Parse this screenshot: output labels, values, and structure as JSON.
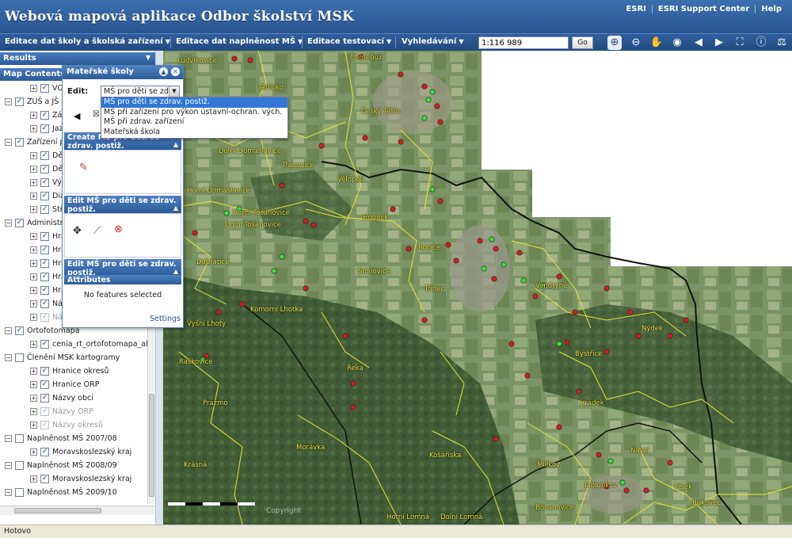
{
  "header": {
    "title": "Webová mapová aplikace Odbor školství MSK",
    "links": [
      "ESRI",
      "ESRI Support Center",
      "Help"
    ]
  },
  "toolbar": {
    "menus": [
      {
        "label": "Editace dat školy a školská zařízení"
      },
      {
        "label": "Editace dat naplněnost MŠ"
      },
      {
        "label": "Editace testovací"
      },
      {
        "label": "Vyhledávání"
      }
    ],
    "scale_value": "1:116 989",
    "go_label": "Go",
    "tools": [
      "zoom-in-icon",
      "zoom-out-icon",
      "pan-hand-icon",
      "globe-icon",
      "back-arrow-icon",
      "forward-arrow-icon",
      "full-extent-icon",
      "info-icon",
      "measure-icon"
    ]
  },
  "left_panel": {
    "results_label": "Results",
    "map_contents_label": "Map Contents",
    "toc": [
      {
        "level": 2,
        "expander": "+",
        "checked": true,
        "label": "VO"
      },
      {
        "level": 0,
        "expander": "-",
        "checked": true,
        "label": "ZUŠ a JŠ"
      },
      {
        "level": 2,
        "expander": "+",
        "checked": true,
        "label": "Zák"
      },
      {
        "level": 2,
        "expander": "+",
        "checked": true,
        "label": "Jazy"
      },
      {
        "level": 0,
        "expander": "-",
        "checked": true,
        "label": "Zařízení p"
      },
      {
        "level": 2,
        "expander": "+",
        "checked": true,
        "label": "Dět"
      },
      {
        "level": 2,
        "expander": "+",
        "checked": true,
        "label": "Dět"
      },
      {
        "level": 2,
        "expander": "+",
        "checked": true,
        "label": "Výc"
      },
      {
        "level": 2,
        "expander": "+",
        "checked": true,
        "label": "Diag"
      },
      {
        "level": 2,
        "expander": "+",
        "checked": true,
        "label": "Stř"
      },
      {
        "level": 0,
        "expander": "-",
        "checked": true,
        "label": "Administra"
      },
      {
        "level": 2,
        "expander": "+",
        "checked": true,
        "label": "Hrani"
      },
      {
        "level": 2,
        "expander": "+",
        "checked": true,
        "label": "Hrani"
      },
      {
        "level": 2,
        "expander": "+",
        "checked": true,
        "label": "Hrani"
      },
      {
        "level": 2,
        "expander": "+",
        "checked": true,
        "label": "Hrani"
      },
      {
        "level": 2,
        "expander": "+",
        "checked": true,
        "label": "Hrani"
      },
      {
        "level": 2,
        "expander": "+",
        "checked": true,
        "label": "Názv"
      },
      {
        "level": 2,
        "expander": "+",
        "checked": true,
        "dim": true,
        "label": "Názv"
      },
      {
        "level": 0,
        "expander": "-",
        "checked": true,
        "label": "Ortofotomapa"
      },
      {
        "level": 2,
        "expander": "+",
        "checked": true,
        "label": "cenia_rt_ortofotomapa_akt"
      },
      {
        "level": 0,
        "expander": "-",
        "checked": false,
        "label": "Členění MSK kartogramy"
      },
      {
        "level": 2,
        "expander": "+",
        "checked": true,
        "label": "Hranice okresů"
      },
      {
        "level": 2,
        "expander": "+",
        "checked": true,
        "label": "Hranice ORP"
      },
      {
        "level": 2,
        "expander": "+",
        "checked": true,
        "label": "Názvy obcí"
      },
      {
        "level": 2,
        "expander": "+",
        "checked": true,
        "dim": true,
        "label": "Názvy ORP"
      },
      {
        "level": 2,
        "expander": "+",
        "checked": true,
        "dim": true,
        "label": "Názvy okresů"
      },
      {
        "level": 0,
        "expander": "-",
        "checked": false,
        "label": "Naplněnost MŠ 2007/08"
      },
      {
        "level": 2,
        "expander": "+",
        "checked": true,
        "label": "Moravskoslezský kraj"
      },
      {
        "level": 0,
        "expander": "-",
        "checked": false,
        "label": "Naplněnost MŠ 2008/09"
      },
      {
        "level": 2,
        "expander": "+",
        "checked": true,
        "label": "Moravskoslezský kraj"
      },
      {
        "level": 0,
        "expander": "-",
        "checked": false,
        "label": "Naplněnost MŠ 2009/10"
      }
    ]
  },
  "editor": {
    "title": "Mateřské školy",
    "edit_label": "Edit:",
    "selected_value": "MŠ pro děti se zdrav. postiž.",
    "options": [
      "MŠ pro děti se zdrav. postiž.",
      "MŠ při zařízení pro výkon ústavní-ochran. vých.",
      "MŠ při zdrav. zařízení",
      "Mateřská škola"
    ],
    "create_title": "Create MŠ pro děti se zdrav. postiž.",
    "edit_title": "Edit MŠ pro děti se zdrav. postiž.",
    "edit_title_2": "Edit MŠ pro děti se zdrav. postiž.",
    "attributes_title": "Attributes",
    "no_features": "No features selected",
    "settings_label": "Settings"
  },
  "map": {
    "places": [
      "Ludvíkovice",
      "Ropice",
      "Český Těšín",
      "Těrlicko",
      "Dolní Domaslavice",
      "Třanovice",
      "Vělopolí",
      "Horní Domaslavice",
      "Hnojník",
      "Horní Tošanovice",
      "Dolní Tošanovice",
      "Smilovice",
      "Dobratice",
      "Komorní Lhotka",
      "Vyšní Lhoty",
      "Třinec",
      "Vendryně",
      "Nýdek",
      "Bystřice",
      "Raškovice",
      "Pražmo",
      "Řeka",
      "Morávka",
      "Hrádek",
      "Košařiska",
      "Milíkov",
      "Návsí",
      "Jablunkov",
      "Krásná",
      "Písek",
      "Bocanovice",
      "Bukovec",
      "Horní Lomná",
      "Dolní Lomná",
      "Chotěbuz"
    ],
    "copyright": "Copyright"
  },
  "status": {
    "text": "Hotovo"
  }
}
